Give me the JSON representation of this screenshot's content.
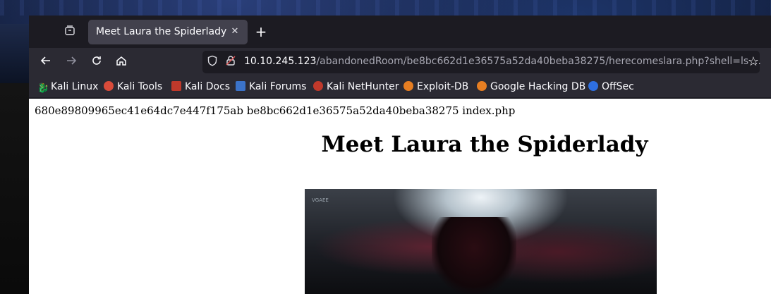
{
  "browser": {
    "tab": {
      "title": "Meet Laura the Spiderlady"
    },
    "url": {
      "host": "10.10.245.123",
      "path": "/abandonedRoom/be8bc662d1e36575a52da40beba38275/herecomeslara.php?shell=ls ..."
    },
    "nav_icons": [
      "back-icon",
      "forward-icon",
      "reload-icon",
      "home-icon"
    ],
    "bookmarks": [
      {
        "label": "Kali Linux",
        "icon": "kali-dragon-icon",
        "color": "#3a3a3a"
      },
      {
        "label": "Kali Tools",
        "icon": "kali-tools-icon",
        "color": "#d94b3a"
      },
      {
        "label": "Kali Docs",
        "icon": "kali-docs-icon",
        "color": "#c0392b"
      },
      {
        "label": "Kali Forums",
        "icon": "kali-forums-icon",
        "color": "#3b73c9"
      },
      {
        "label": "Kali NetHunter",
        "icon": "kali-nethunter-icon",
        "color": "#c0392b"
      },
      {
        "label": "Exploit-DB",
        "icon": "exploit-db-icon",
        "color": "#e67e22"
      },
      {
        "label": "Google Hacking DB",
        "icon": "ghdb-icon",
        "color": "#e67e22"
      },
      {
        "label": "OffSec",
        "icon": "offsec-icon",
        "color": "#2e6fe0"
      }
    ]
  },
  "page": {
    "command_output": "680e89809965ec41e64dc7e447f175ab be8bc662d1e36575a52da40beba38275 index.php",
    "heading": "Meet Laura the Spiderlady",
    "image_watermark": "VGAEE"
  }
}
